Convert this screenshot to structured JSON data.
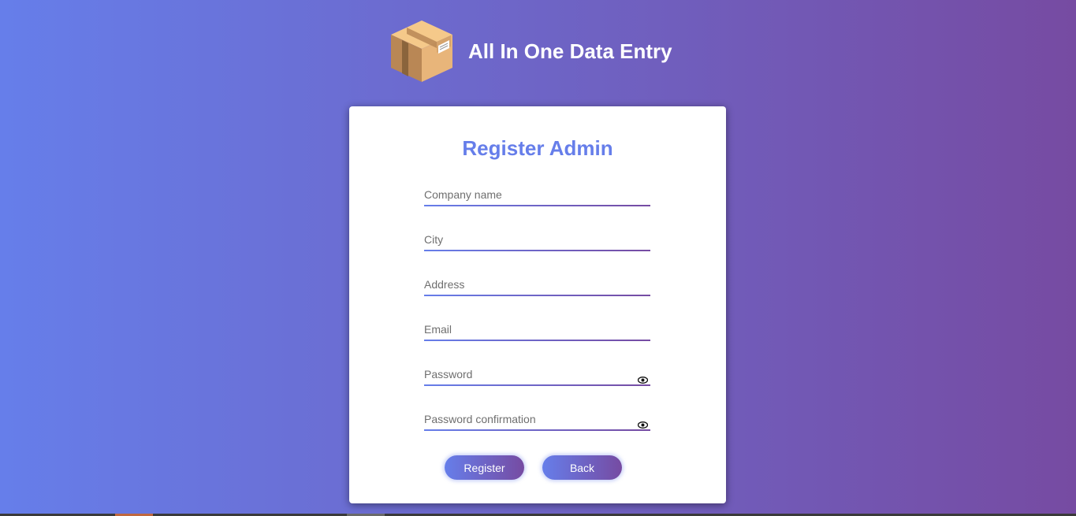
{
  "app": {
    "title": "All In One Data Entry",
    "logo_icon": "package-box-icon"
  },
  "form": {
    "title": "Register Admin",
    "fields": [
      {
        "placeholder": "Company name",
        "value": ""
      },
      {
        "placeholder": "City",
        "value": ""
      },
      {
        "placeholder": "Address",
        "value": ""
      },
      {
        "placeholder": "Email",
        "value": ""
      },
      {
        "placeholder": "Password",
        "value": "",
        "icon": "eye-icon"
      },
      {
        "placeholder": "Password confirmation",
        "value": "",
        "icon": "eye-icon"
      }
    ],
    "register_label": "Register",
    "back_label": "Back"
  },
  "colors": {
    "gradient_start": "#667eea",
    "gradient_end": "#764ba2",
    "title_color": "#667eea"
  }
}
